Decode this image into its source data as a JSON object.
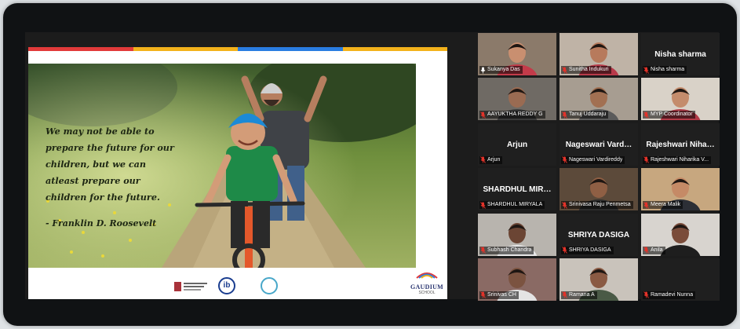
{
  "slide": {
    "stripe_colors": [
      "#e23a3a",
      "#f3b21b",
      "#2a7de1",
      "#f3b21b"
    ],
    "quote_lines": [
      "We may not be able to",
      "prepare the future for our",
      "children, but we can",
      "atleast prepare our",
      "children for the future."
    ],
    "attribution": "-  Franklin D. Roosevelt",
    "school_logo_text": "GAUDIUM",
    "school_logo_sub": "SCHOOL",
    "ib_logo_text": "ib"
  },
  "participants": [
    {
      "name": "Sukanya Das",
      "display_label": "",
      "has_video": true,
      "active": true,
      "muted": false,
      "bg": "#8b7a6a",
      "skin": "#c98f70",
      "shirt": "#c33b4a"
    },
    {
      "name": "Sunitha Indukuri",
      "display_label": "",
      "has_video": true,
      "active": false,
      "muted": true,
      "bg": "#bfb3a6",
      "skin": "#b77a5c",
      "shirt": "#b83a4a"
    },
    {
      "name": "Nisha sharma",
      "display_label": "Nisha sharma",
      "has_video": false,
      "active": false,
      "muted": true
    },
    {
      "name": "AAYUKTHA REDDY G",
      "display_label": "",
      "has_video": true,
      "active": false,
      "muted": true,
      "bg": "#6f6a64",
      "skin": "#9a6b52",
      "shirt": "#3a3a3a"
    },
    {
      "name": "Tanuj Uddaraju",
      "display_label": "",
      "has_video": true,
      "active": false,
      "muted": true,
      "bg": "#a79d91",
      "skin": "#a27052",
      "shirt": "#5b5b5b"
    },
    {
      "name": "MYP Coordinator",
      "display_label": "",
      "has_video": true,
      "active": false,
      "muted": true,
      "bg": "#d9d2c8",
      "skin": "#c48c6c",
      "shirt": "#b23b48"
    },
    {
      "name": "Arjun",
      "display_label": "Arjun",
      "has_video": false,
      "active": false,
      "muted": true
    },
    {
      "name": "Nageswari Vardireddy",
      "display_label": "Nageswari Vard…",
      "has_video": false,
      "active": false,
      "muted": true
    },
    {
      "name": "Rajeshwari Niharika V...",
      "display_label": "Rajeshwari Niha…",
      "has_video": false,
      "active": false,
      "muted": true
    },
    {
      "name": "SHARDHUL MIRYALA",
      "display_label": "SHARDHUL MIR…",
      "has_video": false,
      "active": false,
      "muted": true
    },
    {
      "name": "Srinivasa Raju Penmetsa",
      "display_label": "",
      "has_video": true,
      "active": false,
      "muted": true,
      "bg": "#5c4a3a",
      "skin": "#8f5f44",
      "shirt": "#2c2c2c"
    },
    {
      "name": "Meera Malik",
      "display_label": "",
      "has_video": true,
      "active": false,
      "muted": true,
      "bg": "#c7a77f",
      "skin": "#c58a66",
      "shirt": "#2c2f36"
    },
    {
      "name": "Subhash Chandra",
      "display_label": "",
      "has_video": true,
      "active": false,
      "muted": true,
      "bg": "#b8b4ae",
      "skin": "#6b4534",
      "shirt": "#e8e8e8"
    },
    {
      "name": "SHRIYA DASIGA",
      "display_label": "SHRIYA DASIGA",
      "has_video": false,
      "active": false,
      "muted": true
    },
    {
      "name": "Anila",
      "display_label": "",
      "has_video": true,
      "active": false,
      "muted": true,
      "bg": "#d8d4cf",
      "skin": "#7a4c3a",
      "shirt": "#1e1e1e"
    },
    {
      "name": "Srinivas CH",
      "display_label": "",
      "has_video": true,
      "active": false,
      "muted": true,
      "bg": "#8a6a64",
      "skin": "#7b5340",
      "shirt": "#e4e4e4"
    },
    {
      "name": "Ramana A",
      "display_label": "",
      "has_video": true,
      "active": false,
      "muted": true,
      "bg": "#c9c3bb",
      "skin": "#8a5a43",
      "shirt": "#4a5a46"
    },
    {
      "name": "Ramadevi Nunna",
      "display_label": "",
      "has_video": false,
      "active": false,
      "muted": true
    }
  ],
  "colors": {
    "muted_icon": "#e5332a",
    "active_border": "#c8f050",
    "tile_bg": "#1f1f1f"
  }
}
